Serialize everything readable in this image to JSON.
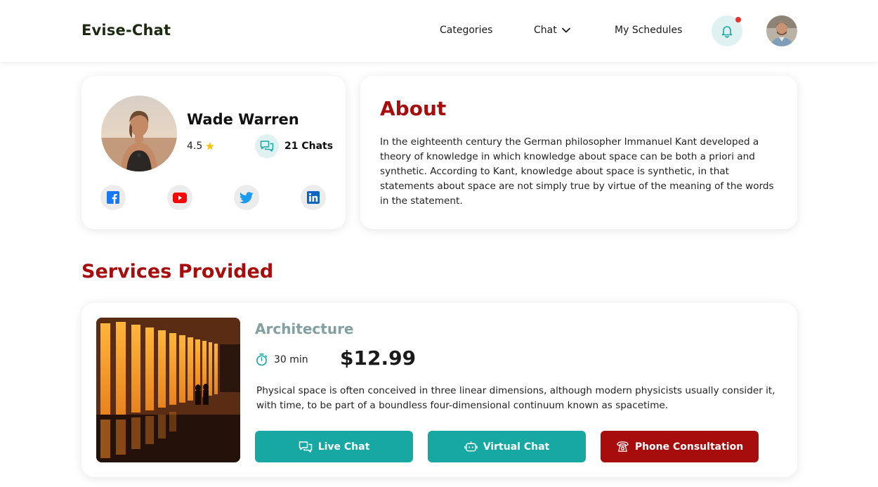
{
  "header": {
    "logo": "Evise-Chat",
    "nav": {
      "categories": "Categories",
      "chat": "Chat",
      "schedules": "My Schedules"
    },
    "notification_icon": "bell-icon",
    "has_unread_notification": true
  },
  "profile": {
    "name": "Wade Warren",
    "rating": "4.5",
    "chats": "21 Chats",
    "socials": [
      "facebook-icon",
      "youtube-icon",
      "twitter-icon",
      "linkedin-icon"
    ]
  },
  "about": {
    "title": "About",
    "text": "In the eighteenth century the German philosopher Immanuel Kant developed a theory of knowledge in which knowledge about space can be both a priori and synthetic. According to Kant, knowledge about space is synthetic, in that statements about space are not simply true by virtue of the meaning of the words in the statement."
  },
  "services": {
    "title": "Services Provided",
    "items": [
      {
        "name": "Architecture",
        "duration": "30 min",
        "price": "$12.99",
        "description": "Physical space is often conceived in three linear dimensions, although modern physicists usually consider it, with time, to be part of a boundless four-dimensional continuum known as spacetime.",
        "buttons": {
          "live_chat": "Live Chat",
          "virtual_chat": "Virtual Chat",
          "phone": "Phone Consultation"
        }
      }
    ]
  },
  "colors": {
    "brand_red": "#a70d0d",
    "teal": "#17a8a3",
    "teal_light": "#dff1f0",
    "muted_teal": "#83a0a0"
  }
}
